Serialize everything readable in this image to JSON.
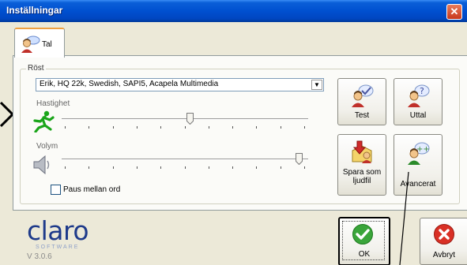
{
  "window": {
    "title": "Inställningar",
    "close_glyph": "✕"
  },
  "tabs": [
    {
      "label": "Tal",
      "icon": "person-speech-icon",
      "active": true
    }
  ],
  "group": {
    "label": "Röst"
  },
  "voice_select": {
    "selected": "Erik, HQ 22k, Swedish, SAPI5, Acapela Multimedia",
    "arrow": "▼"
  },
  "speed": {
    "label": "Hastighet",
    "icon": "running-man-icon",
    "value_fraction": 0.52
  },
  "volume": {
    "label": "Volym",
    "icon": "speaker-icon",
    "value_fraction": 0.96
  },
  "pause_checkbox": {
    "label": "Paus mellan ord",
    "checked": false
  },
  "buttons": {
    "test": {
      "label": "Test",
      "icon": "person-check-icon"
    },
    "uttal": {
      "label": "Uttal",
      "icon": "person-question-icon"
    },
    "save_audio": {
      "label_line1": "Spara som",
      "label_line2": "ljudfil",
      "icon": "save-audio-icon"
    },
    "advanced": {
      "label": "Avancerat",
      "icon": "person-plus-icon"
    },
    "ok": {
      "label": "OK",
      "icon": "green-check-icon"
    },
    "cancel": {
      "label": "Avbryt",
      "icon": "red-x-icon"
    }
  },
  "brand": {
    "logo": "claro",
    "sub": "SOFTWARE",
    "version": "V 3.0.6"
  },
  "colors": {
    "titlebar": "#0054e3",
    "ok_green": "#3aa53a",
    "cancel_red": "#d93025",
    "speed_icon": "#1aa51a"
  }
}
